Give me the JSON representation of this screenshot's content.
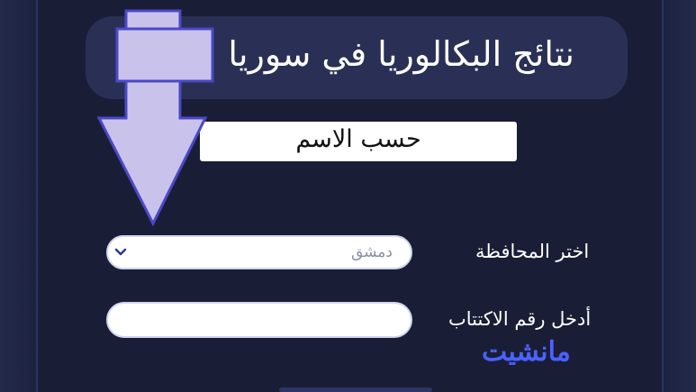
{
  "page": {
    "title": "نتائج البكالوريا في سوريا",
    "search_mode": "حسب الاسم",
    "governorate_label": "اختر المحافظة",
    "governorate_value": "دمشق",
    "exam_number_label": "أدخل رقم الاكتتاب",
    "exam_number_value": "",
    "watermark": "مانشيت"
  },
  "colors": {
    "background": "#1a1e38",
    "title_pill": "#2a3055",
    "arrow_fill": "#c9c3ec",
    "arrow_stroke": "#4b48c8",
    "watermark": "#4a62ff"
  }
}
